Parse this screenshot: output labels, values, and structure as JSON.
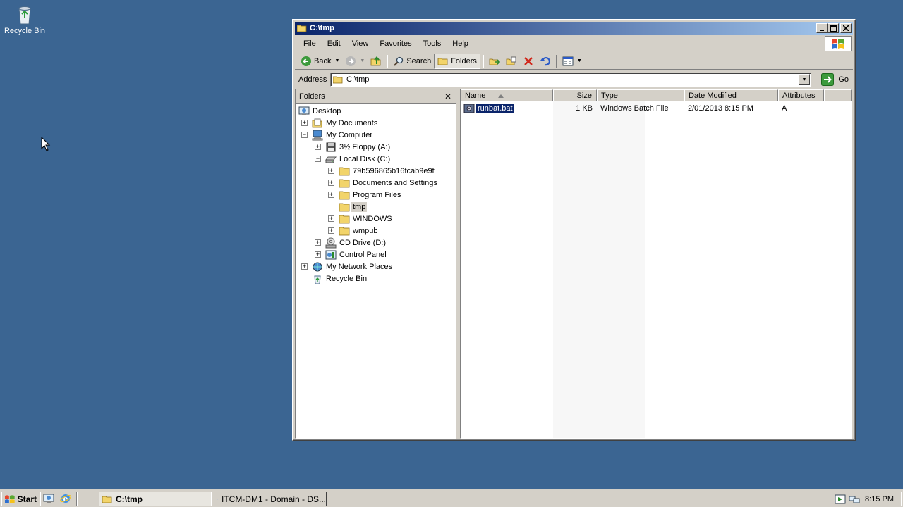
{
  "desktop": {
    "recycle_bin_label": "Recycle Bin"
  },
  "window": {
    "title": "C:\\tmp",
    "menu": [
      "File",
      "Edit",
      "View",
      "Favorites",
      "Tools",
      "Help"
    ],
    "toolbar": {
      "back": "Back",
      "search": "Search",
      "folders": "Folders"
    },
    "address": {
      "label": "Address",
      "value": "C:\\tmp",
      "go": "Go"
    },
    "folders_pane": {
      "title": "Folders",
      "tree": [
        {
          "label": "Desktop"
        },
        {
          "label": "My Documents"
        },
        {
          "label": "My Computer"
        },
        {
          "label": "3½ Floppy (A:)"
        },
        {
          "label": "Local Disk (C:)"
        },
        {
          "label": "79b596865b16fcab9e9f"
        },
        {
          "label": "Documents and Settings"
        },
        {
          "label": "Program Files"
        },
        {
          "label": "tmp"
        },
        {
          "label": "WINDOWS"
        },
        {
          "label": "wmpub"
        },
        {
          "label": "CD Drive (D:)"
        },
        {
          "label": "Control Panel"
        },
        {
          "label": "My Network Places"
        },
        {
          "label": "Recycle Bin"
        }
      ]
    },
    "file_list": {
      "columns": [
        "Name",
        "Size",
        "Type",
        "Date Modified",
        "Attributes"
      ],
      "rows": [
        {
          "name": "runbat.bat",
          "size": "1 KB",
          "type": "Windows Batch File",
          "date": "2/01/2013 8:15 PM",
          "attributes": "A"
        }
      ]
    }
  },
  "taskbar": {
    "start": "Start",
    "tasks": [
      "C:\\tmp",
      "ITCM-DM1 - Domain - DS..."
    ],
    "clock": "8:15 PM"
  }
}
